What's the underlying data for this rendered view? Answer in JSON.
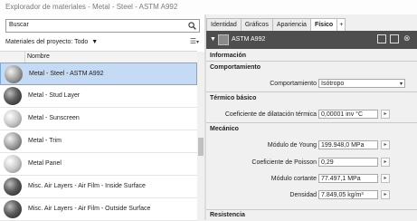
{
  "window": {
    "title": "Explorador de materiales - Metal - Steel - ASTM A992"
  },
  "left": {
    "search_value": "Buscar",
    "project_label": "Materiales del proyecto: Todo",
    "column_header": "Nombre",
    "materials": [
      {
        "label": "Metal - Steel - ASTM A992",
        "selected": true,
        "thumb": "sphere-grey"
      },
      {
        "label": "Metal - Stud Layer",
        "selected": false,
        "thumb": "sphere-dark"
      },
      {
        "label": "Metal - Sunscreen",
        "selected": false,
        "thumb": "sphere-light"
      },
      {
        "label": "Metal - Trim",
        "selected": false,
        "thumb": "sphere-grey"
      },
      {
        "label": "Metal Panel",
        "selected": false,
        "thumb": "sphere-light"
      },
      {
        "label": "Misc. Air Layers - Air Film - Inside Surface",
        "selected": false,
        "thumb": "sphere-dark"
      },
      {
        "label": "Misc. Air Layers - Air Film - Outside Surface",
        "selected": false,
        "thumb": "sphere-dark"
      }
    ]
  },
  "right": {
    "tabs": [
      "Identidad",
      "Gráficos",
      "Apariencia",
      "Físico",
      "+"
    ],
    "active_tab": "Físico",
    "asset_name": "ASTM A992",
    "sections": {
      "informacion": "Información",
      "comportamiento": "Comportamiento",
      "termico": "Térmico básico",
      "mecanico": "Mecánico",
      "resistencia": "Resistencia"
    },
    "fields": {
      "comportamiento_label": "Comportamiento",
      "comportamiento_value": "Isótropo",
      "dilatacion_label": "Coeficiente de dilatación térmica",
      "dilatacion_value": "0,00001 inv °C",
      "young_label": "Módulo de Young",
      "young_value": "199.948,0 MPa",
      "poisson_label": "Coeficiente de Poisson",
      "poisson_value": "0,29",
      "cortante_label": "Módulo cortante",
      "cortante_value": "77.497,1 MPa",
      "densidad_label": "Densidad",
      "densidad_value": "7.849,05 kg/m³"
    }
  }
}
